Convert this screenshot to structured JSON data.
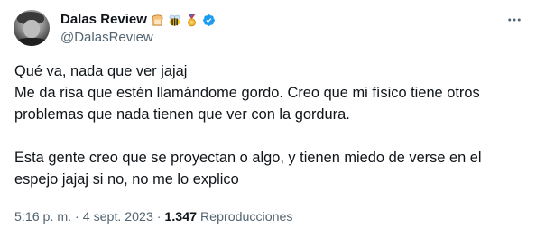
{
  "author": {
    "name": "Dalas Review",
    "handle": "@DalasReview",
    "badges": [
      "bread-emoji",
      "bee-emoji",
      "medal-emoji",
      "verified-badge-icon"
    ]
  },
  "tweet": {
    "lines": [
      "Qué va, nada que ver jajaj",
      "Me da risa que estén llamándome gordo. Creo que mi físico tiene otros",
      "problemas que nada tienen que ver con la gordura.",
      "Esta gente creo que se proyectan o algo, y tienen miedo de verse en el",
      "espejo jajaj si no, no me lo explico"
    ]
  },
  "meta": {
    "time": "5:16 p. m.",
    "separator": "·",
    "date": "4 sept. 2023",
    "views_count": "1.347",
    "views_label": "Reproducciones"
  },
  "colors": {
    "text": "#0f1419",
    "secondary": "#536471",
    "verified": "#1d9bf0"
  }
}
